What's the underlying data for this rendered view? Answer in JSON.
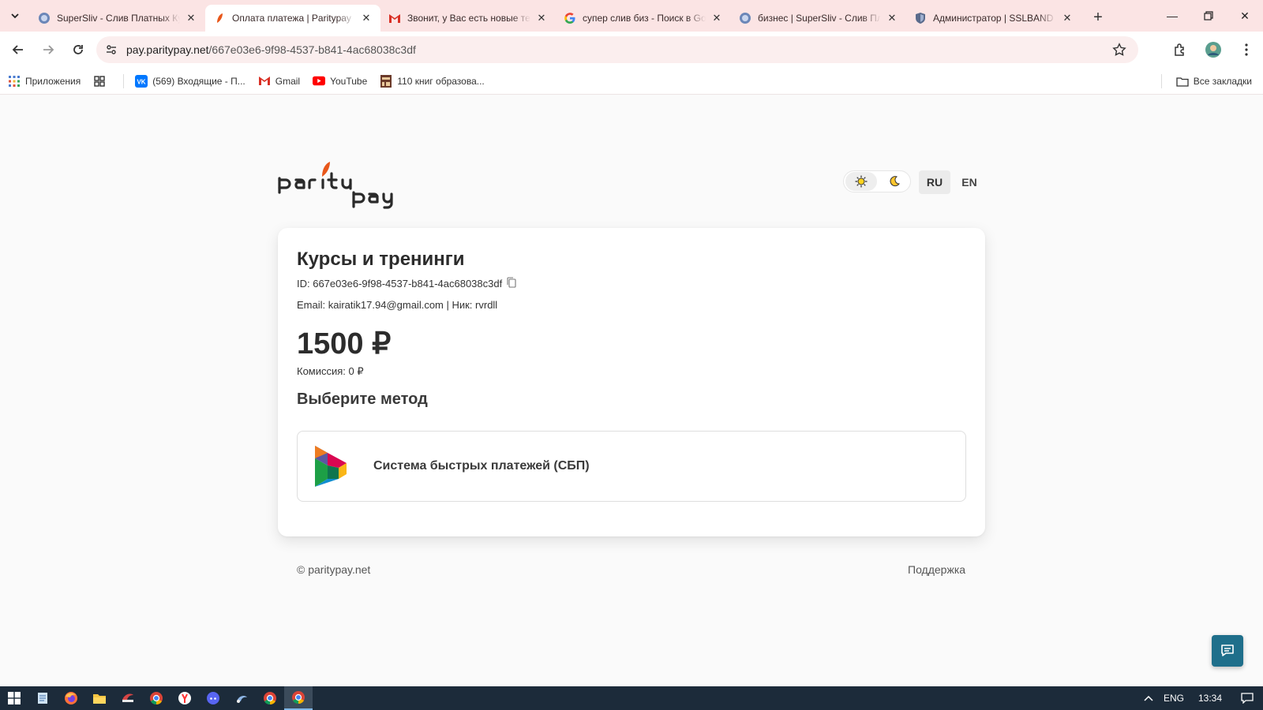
{
  "browser": {
    "tabs": [
      {
        "title": "SuperSliv - Слив Платных Курсов",
        "icon": "globe-icon",
        "active": false
      },
      {
        "title": "Оплата платежа | Paritypay",
        "icon": "paritypay-leaf-icon",
        "active": true
      },
      {
        "title": "Звонит, у Вас есть новые темы",
        "icon": "gmail-icon",
        "active": false
      },
      {
        "title": "супер слив биз - Поиск в Google",
        "icon": "google-icon",
        "active": false
      },
      {
        "title": "бизнес | SuperSliv - Слив Платных",
        "icon": "globe-icon",
        "active": false
      },
      {
        "title": "Администратор | SSLBAND",
        "icon": "shield-icon",
        "active": false
      }
    ],
    "new_tab_label": "+",
    "url_host": "pay.paritypay.net",
    "url_path": "/667e03e6-9f98-4537-b841-4ac68038c3df",
    "bookmarks": [
      {
        "label": "Приложения",
        "icon": "apps-grid-icon"
      },
      {
        "label": "",
        "icon": "tab-groups-icon"
      },
      {
        "label": "(569) Входящие - П...",
        "icon": "vk-icon"
      },
      {
        "label": "Gmail",
        "icon": "gmail-icon"
      },
      {
        "label": "YouTube",
        "icon": "youtube-icon"
      },
      {
        "label": "110 книг образова...",
        "icon": "book-icon"
      }
    ],
    "all_bookmarks_label": "Все закладки"
  },
  "page": {
    "theme": {
      "light_icon": "sun-icon",
      "dark_icon": "moon-icon",
      "selected": "light"
    },
    "languages": [
      "RU",
      "EN"
    ],
    "selected_language": "RU",
    "card": {
      "title": "Курсы и тренинги",
      "id_line": "ID: 667e03e6-9f98-4537-b841-4ac68038c3df",
      "email_line": "Email: kairatik17.94@gmail.com | Ник: rvrdll",
      "amount": "1500 ₽",
      "fee": "Комиссия: 0 ₽",
      "method_title": "Выберите метод",
      "methods": [
        {
          "label": "Система быстрых платежей (СБП)",
          "icon": "sbp-logo-icon"
        }
      ]
    },
    "footer": {
      "copyright": "© paritypay.net",
      "support": "Поддержка"
    }
  },
  "taskbar": {
    "apps": [
      "windows-start-icon",
      "notepad-icon",
      "firefox-icon",
      "explorer-icon",
      "app-icon",
      "chrome-icon",
      "yandex-icon",
      "discord-icon",
      "app2-icon",
      "chrome-icon",
      "chrome-canary-icon"
    ],
    "language": "ENG",
    "time": "13:34"
  },
  "colors": {
    "tabstrip": "#fbe4e4",
    "accent_orange": "#e8571a",
    "chat_button": "#1f6f8b",
    "taskbar": "#1c2b3a"
  }
}
